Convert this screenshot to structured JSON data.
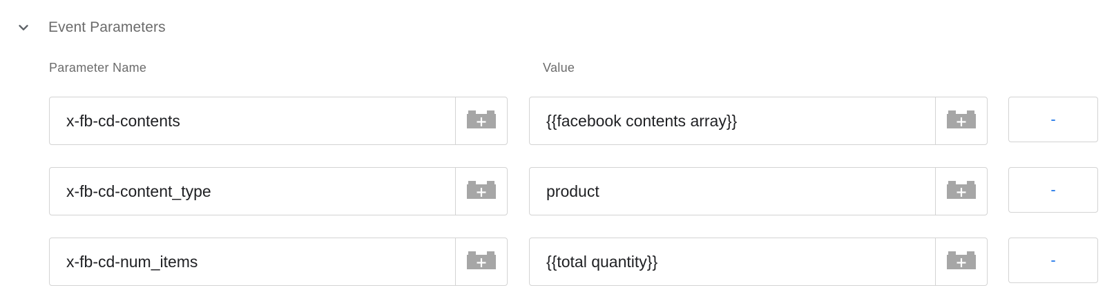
{
  "section": {
    "title": "Event Parameters",
    "icon": "chevron-down-icon"
  },
  "columns": {
    "name_label": "Parameter Name",
    "value_label": "Value"
  },
  "rows": [
    {
      "name": "x-fb-cd-contents",
      "value": "{{facebook contents array}}",
      "remove_label": "-"
    },
    {
      "name": "x-fb-cd-content_type",
      "value": "product",
      "remove_label": "-"
    },
    {
      "name": "x-fb-cd-num_items",
      "value": "{{total quantity}}",
      "remove_label": "-"
    }
  ],
  "icons": {
    "variable_picker": "add-variable-icon"
  },
  "colors": {
    "accent": "#1a73e8",
    "muted_text": "#6b6b6b",
    "border": "#d3d3d3",
    "icon": "#a6a6a6"
  }
}
